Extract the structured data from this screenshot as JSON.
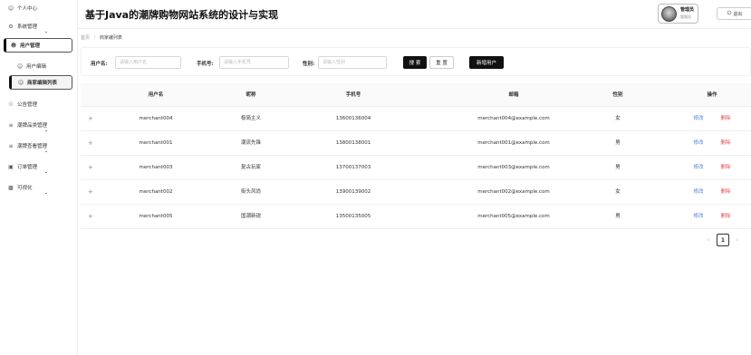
{
  "app": {
    "title": "基于Java的潮牌购物网站系统的设计与实现"
  },
  "header": {
    "user_name": "管理员",
    "user_role": "管理员",
    "logout_label": "退出"
  },
  "sidebar": {
    "items": [
      {
        "label": "个人中心",
        "icon": "user-icon"
      },
      {
        "label": "系统管理",
        "icon": "gear-icon"
      },
      {
        "label": "用户管理",
        "icon": "users-icon",
        "active": true
      },
      {
        "label": "用户编辑",
        "icon": "user-icon",
        "sub": true
      },
      {
        "label": "商家编辑列表",
        "icon": "user-icon",
        "sub": true,
        "active": true
      },
      {
        "label": "公告管理",
        "icon": "speaker-icon"
      },
      {
        "label": "潮牌品类管理",
        "icon": "menu-icon"
      },
      {
        "label": "潮牌查看管理",
        "icon": "menu-icon"
      },
      {
        "label": "订单管理",
        "icon": "order-icon"
      },
      {
        "label": "可视化",
        "icon": "chart-icon"
      }
    ]
  },
  "breadcrumb": {
    "home": "首页",
    "separator": "/",
    "current": "商家编列表"
  },
  "search": {
    "username_label": "用户名:",
    "username_placeholder": "请输入用户名",
    "phone_label": "手机号:",
    "phone_placeholder": "请输入手机号",
    "gender_label": "性别:",
    "gender_placeholder": "请输入性别",
    "search_btn": "搜 索",
    "reset_btn": "重 置",
    "add_btn": "新增用户"
  },
  "table": {
    "columns": [
      "用户名",
      "昵称",
      "手机号",
      "邮箱",
      "性别",
      "操作"
    ],
    "expand_symbol": "+",
    "edit_label": "修改",
    "delete_label": "删除",
    "rows": [
      {
        "username": "merchant004",
        "nickname": "极简主义",
        "phone": "13600136004",
        "email": "merchant004@example.com",
        "gender": "女"
      },
      {
        "username": "merchant001",
        "nickname": "潮流先锋",
        "phone": "13800138001",
        "email": "merchant001@example.com",
        "gender": "男"
      },
      {
        "username": "merchant003",
        "nickname": "复古玩家",
        "phone": "13700137003",
        "email": "merchant003@example.com",
        "gender": "男"
      },
      {
        "username": "merchant002",
        "nickname": "街头风尚",
        "phone": "13900139002",
        "email": "merchant002@example.com",
        "gender": "女"
      },
      {
        "username": "merchant005",
        "nickname": "国潮新锐",
        "phone": "13500135005",
        "email": "merchant005@example.com",
        "gender": "男"
      }
    ]
  },
  "pagination": {
    "prev": "‹",
    "current": "1",
    "next": "›"
  }
}
